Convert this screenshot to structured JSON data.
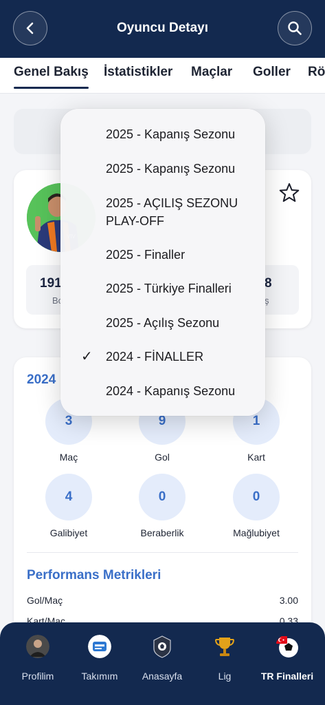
{
  "header": {
    "title": "Oyuncu Detayı"
  },
  "tabs": [
    {
      "label": "Genel Bakış",
      "active": true
    },
    {
      "label": "İstatistikler",
      "active": false
    },
    {
      "label": "Maçlar",
      "active": false
    },
    {
      "label": "Goller",
      "active": false
    },
    {
      "label": "Röp",
      "active": false
    }
  ],
  "player_card": {
    "stat_left_value": "191",
    "stat_left_label": "Bo",
    "stat_right_value": "8",
    "stat_right_label": "ş"
  },
  "season_stats": {
    "year_label": "2024",
    "items": [
      {
        "value": "3",
        "label": "Maç"
      },
      {
        "value": "9",
        "label": "Gol"
      },
      {
        "value": "1",
        "label": "Kart"
      },
      {
        "value": "4",
        "label": "Galibiyet"
      },
      {
        "value": "0",
        "label": "Beraberlik"
      },
      {
        "value": "0",
        "label": "Mağlubiyet"
      }
    ],
    "performance_title": "Performans Metrikleri",
    "metrics": [
      {
        "label": "Gol/Maç",
        "value": "3.00"
      },
      {
        "label": "Kart/Maç",
        "value": "0.33"
      }
    ]
  },
  "dropdown": {
    "options": [
      {
        "label": "2025 - Kapanış Sezonu",
        "selected": false
      },
      {
        "label": "2025 - Kapanış Sezonu",
        "selected": false
      },
      {
        "label": "2025 - AÇILIŞ SEZONU PLAY-OFF",
        "selected": false
      },
      {
        "label": "2025 - Finaller",
        "selected": false
      },
      {
        "label": "2025 - Türkiye Finalleri",
        "selected": false
      },
      {
        "label": "2025 - Açılış Sezonu",
        "selected": false
      },
      {
        "label": "2024 - FİNALLER",
        "selected": true
      },
      {
        "label": "2024 - Kapanış Sezonu",
        "selected": false
      }
    ],
    "check_glyph": "✓"
  },
  "bottom_nav": [
    {
      "label": "Profilim",
      "icon": "profile-photo-icon",
      "active": false
    },
    {
      "label": "Takımım",
      "icon": "team-logo-icon",
      "active": false
    },
    {
      "label": "Anasayfa",
      "icon": "league-logo-icon",
      "active": false
    },
    {
      "label": "Lig",
      "icon": "trophy-icon",
      "active": false
    },
    {
      "label": "TR Finalleri",
      "icon": "turkey-football-icon",
      "active": true
    }
  ],
  "colors": {
    "header_bg": "#13294f",
    "accent": "#3a6fc8",
    "circle_bg": "#e4ecfb",
    "avatar_bg": "#57c25a"
  }
}
